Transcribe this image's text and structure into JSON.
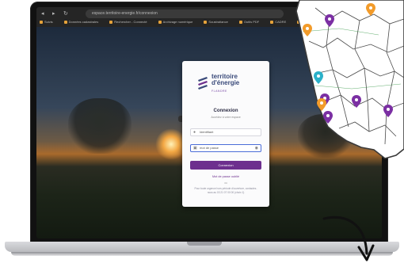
{
  "browser": {
    "url": "espace.territoire-energie.fr/connexion",
    "bookmarks": [
      "Suivis",
      "Données cadastrales",
      "Rechercher - Connecté",
      "Archivage numérique",
      "Soustraitance",
      "Outils PDF",
      "CADRE",
      "DECLIC"
    ],
    "nav_back": "◂",
    "nav_forward": "▸",
    "nav_reload": "↻"
  },
  "login": {
    "logo_line1": "territoire",
    "logo_line2": "d'énergie",
    "logo_sub": "FLANDRE",
    "title": "Connexion",
    "subtitle": "Accédez à votre espace",
    "identifier_placeholder": "Identifiant",
    "password_placeholder": "mot de passe",
    "submit_label": "Connexion",
    "forgot_label": "Mot de passe oublié",
    "or_label": "ou",
    "help_text": "Pour toute urgence hors période d'ouverture, contactez-nous au 03 21 07 00 00 (choix 1)"
  },
  "icons": {
    "user": "user-icon",
    "lock": "lock-icon",
    "eye": "eye-icon"
  },
  "colors": {
    "brand_blue": "#3a4a7a",
    "brand_purple": "#6d2f8e",
    "map_pin_purple": "#7b2fa3",
    "map_pin_orange": "#f29b2a",
    "map_pin_teal": "#2bb1c9"
  }
}
